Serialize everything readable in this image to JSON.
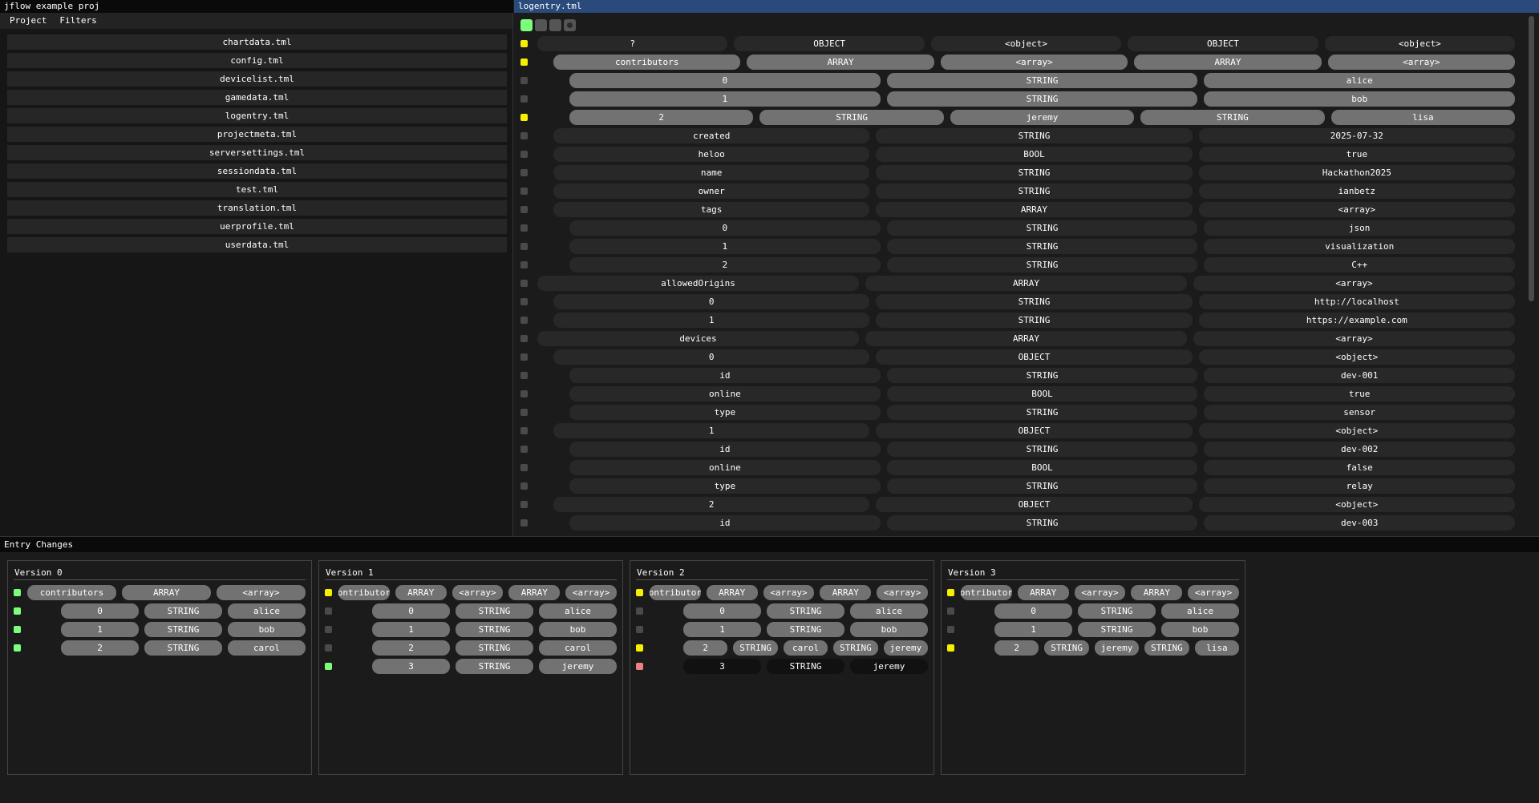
{
  "left": {
    "title": "jflow example proj",
    "menu": [
      "Project",
      "Filters"
    ],
    "files": [
      "chartdata.tml",
      "config.tml",
      "devicelist.tml",
      "gamedata.tml",
      "logentry.tml",
      "projectmeta.tml",
      "serversettings.tml",
      "sessiondata.tml",
      "test.tml",
      "translation.tml",
      "uerprofile.tml",
      "userdata.tml"
    ]
  },
  "main": {
    "title": "logentry.tml",
    "toolbar": [
      {
        "name": "toggle-green-button",
        "state": "on"
      },
      {
        "name": "toggle-button-2",
        "state": "off"
      },
      {
        "name": "toggle-button-3",
        "state": "off"
      },
      {
        "name": "radio-button",
        "state": "off"
      }
    ],
    "rows": [
      {
        "level": 0,
        "marker": "yellow",
        "style": "dark",
        "cells": [
          "?",
          "OBJECT",
          "<object>",
          "OBJECT",
          "<object>"
        ]
      },
      {
        "level": 1,
        "marker": "yellow",
        "style": "light",
        "cells": [
          "contributors",
          "ARRAY",
          "<array>",
          "ARRAY",
          "<array>"
        ]
      },
      {
        "level": 2,
        "marker": "gray",
        "style": "light",
        "cells": [
          "0",
          "STRING",
          "alice"
        ]
      },
      {
        "level": 2,
        "marker": "gray",
        "style": "light",
        "cells": [
          "1",
          "STRING",
          "bob"
        ]
      },
      {
        "level": 2,
        "marker": "yellow",
        "style": "light",
        "cells": [
          "2",
          "STRING",
          "jeremy",
          "STRING",
          "lisa"
        ]
      },
      {
        "level": 1,
        "marker": "gray",
        "style": "dark",
        "cells": [
          "created",
          "STRING",
          "2025-07-32"
        ]
      },
      {
        "level": 1,
        "marker": "gray",
        "style": "dark",
        "cells": [
          "heloo",
          "BOOL",
          "true"
        ]
      },
      {
        "level": 1,
        "marker": "gray",
        "style": "dark",
        "cells": [
          "name",
          "STRING",
          "Hackathon2025"
        ]
      },
      {
        "level": 1,
        "marker": "gray",
        "style": "dark",
        "cells": [
          "owner",
          "STRING",
          "ianbetz"
        ]
      },
      {
        "level": 1,
        "marker": "gray",
        "style": "dark",
        "cells": [
          "tags",
          "ARRAY",
          "<array>"
        ]
      },
      {
        "level": 2,
        "marker": "gray",
        "style": "dark",
        "cells": [
          "0",
          "STRING",
          "json"
        ]
      },
      {
        "level": 2,
        "marker": "gray",
        "style": "dark",
        "cells": [
          "1",
          "STRING",
          "visualization"
        ]
      },
      {
        "level": 2,
        "marker": "gray",
        "style": "dark",
        "cells": [
          "2",
          "STRING",
          "C++"
        ]
      },
      {
        "level": 0,
        "marker": "gray",
        "style": "dark",
        "cells": [
          "allowedOrigins",
          "ARRAY",
          "<array>"
        ]
      },
      {
        "level": 1,
        "marker": "gray",
        "style": "dark",
        "cells": [
          "0",
          "STRING",
          "http://localhost"
        ]
      },
      {
        "level": 1,
        "marker": "gray",
        "style": "dark",
        "cells": [
          "1",
          "STRING",
          "https://example.com"
        ]
      },
      {
        "level": 0,
        "marker": "gray",
        "style": "dark",
        "cells": [
          "devices",
          "ARRAY",
          "<array>"
        ]
      },
      {
        "level": 1,
        "marker": "gray",
        "style": "dark",
        "cells": [
          "0",
          "OBJECT",
          "<object>"
        ]
      },
      {
        "level": 2,
        "marker": "gray",
        "style": "dark",
        "cells": [
          "id",
          "STRING",
          "dev-001"
        ]
      },
      {
        "level": 2,
        "marker": "gray",
        "style": "dark",
        "cells": [
          "online",
          "BOOL",
          "true"
        ]
      },
      {
        "level": 2,
        "marker": "gray",
        "style": "dark",
        "cells": [
          "type",
          "STRING",
          "sensor"
        ]
      },
      {
        "level": 1,
        "marker": "gray",
        "style": "dark",
        "cells": [
          "1",
          "OBJECT",
          "<object>"
        ]
      },
      {
        "level": 2,
        "marker": "gray",
        "style": "dark",
        "cells": [
          "id",
          "STRING",
          "dev-002"
        ]
      },
      {
        "level": 2,
        "marker": "gray",
        "style": "dark",
        "cells": [
          "online",
          "BOOL",
          "false"
        ]
      },
      {
        "level": 2,
        "marker": "gray",
        "style": "dark",
        "cells": [
          "type",
          "STRING",
          "relay"
        ]
      },
      {
        "level": 1,
        "marker": "gray",
        "style": "dark",
        "cells": [
          "2",
          "OBJECT",
          "<object>"
        ]
      },
      {
        "level": 2,
        "marker": "gray",
        "style": "dark",
        "cells": [
          "id",
          "STRING",
          "dev-003"
        ]
      }
    ]
  },
  "bottom": {
    "title": "Entry Changes",
    "versions": [
      {
        "title": "Version 0",
        "rows": [
          {
            "level": 0,
            "marker": "green",
            "style": "light",
            "cells": [
              "contributors",
              "ARRAY",
              "<array>"
            ]
          },
          {
            "level": 1,
            "marker": "green",
            "style": "light",
            "cells": [
              "0",
              "STRING",
              "alice"
            ]
          },
          {
            "level": 1,
            "marker": "green",
            "style": "light",
            "cells": [
              "1",
              "STRING",
              "bob"
            ]
          },
          {
            "level": 1,
            "marker": "green",
            "style": "light",
            "cells": [
              "2",
              "STRING",
              "carol"
            ]
          }
        ]
      },
      {
        "title": "Version 1",
        "rows": [
          {
            "level": 0,
            "marker": "yellow",
            "style": "light",
            "cells": [
              "contributors",
              "ARRAY",
              "<array>",
              "ARRAY",
              "<array>"
            ]
          },
          {
            "level": 1,
            "marker": "gray",
            "style": "light",
            "cells": [
              "0",
              "STRING",
              "alice"
            ]
          },
          {
            "level": 1,
            "marker": "gray",
            "style": "light",
            "cells": [
              "1",
              "STRING",
              "bob"
            ]
          },
          {
            "level": 1,
            "marker": "gray",
            "style": "light",
            "cells": [
              "2",
              "STRING",
              "carol"
            ]
          },
          {
            "level": 1,
            "marker": "green",
            "style": "light",
            "cells": [
              "3",
              "STRING",
              "jeremy"
            ]
          }
        ]
      },
      {
        "title": "Version 2",
        "rows": [
          {
            "level": 0,
            "marker": "yellow",
            "style": "light",
            "cells": [
              "contributors",
              "ARRAY",
              "<array>",
              "ARRAY",
              "<array>"
            ]
          },
          {
            "level": 1,
            "marker": "gray",
            "style": "light",
            "cells": [
              "0",
              "STRING",
              "alice"
            ]
          },
          {
            "level": 1,
            "marker": "gray",
            "style": "light",
            "cells": [
              "1",
              "STRING",
              "bob"
            ]
          },
          {
            "level": 1,
            "marker": "yellow",
            "style": "light",
            "cells": [
              "2",
              "STRING",
              "carol",
              "STRING",
              "jeremy"
            ]
          },
          {
            "level": 1,
            "marker": "red",
            "style": "black",
            "cells": [
              "3",
              "STRING",
              "jeremy"
            ]
          }
        ]
      },
      {
        "title": "Version 3",
        "rows": [
          {
            "level": 0,
            "marker": "yellow",
            "style": "light",
            "cells": [
              "contributors",
              "ARRAY",
              "<array>",
              "ARRAY",
              "<array>"
            ]
          },
          {
            "level": 1,
            "marker": "gray",
            "style": "light",
            "cells": [
              "0",
              "STRING",
              "alice"
            ]
          },
          {
            "level": 1,
            "marker": "gray",
            "style": "light",
            "cells": [
              "1",
              "STRING",
              "bob"
            ]
          },
          {
            "level": 1,
            "marker": "yellow",
            "style": "light",
            "cells": [
              "2",
              "STRING",
              "jeremy",
              "STRING",
              "lisa"
            ]
          }
        ]
      }
    ]
  }
}
